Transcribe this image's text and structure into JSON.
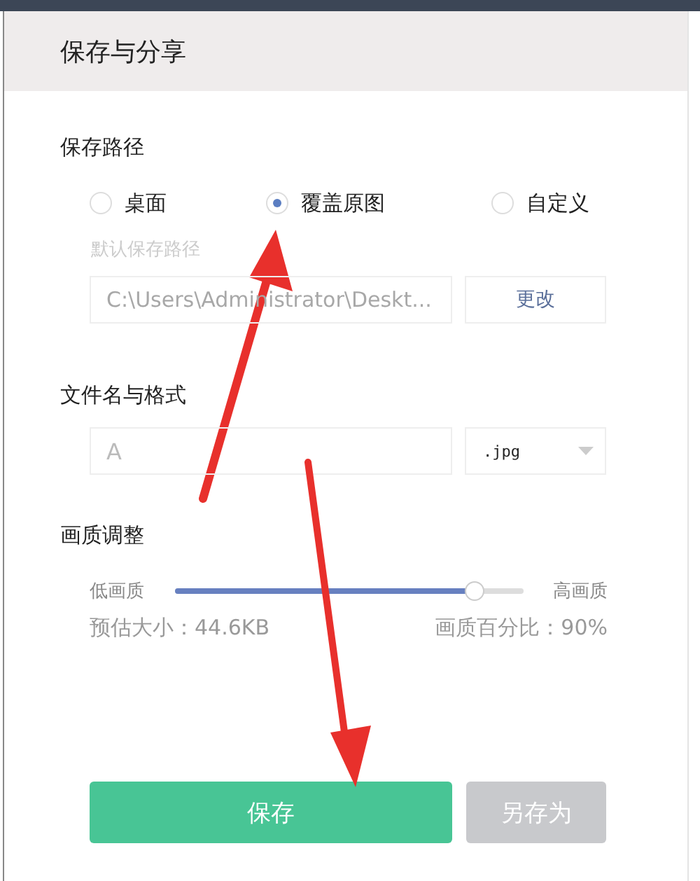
{
  "dialog": {
    "title": "保存与分享"
  },
  "save_path": {
    "label": "保存路径",
    "options": [
      {
        "label": "桌面",
        "selected": false
      },
      {
        "label": "覆盖原图",
        "selected": true
      },
      {
        "label": "自定义",
        "selected": false
      }
    ],
    "path_caption": "默认保存路径",
    "path_value": "C:\\Users\\Administrator\\Deskt...",
    "change_button": "更改",
    "disabled": true
  },
  "file": {
    "label": "文件名与格式",
    "name_value": "A",
    "format": ".jpg"
  },
  "quality": {
    "label": "画质调整",
    "low_label": "低画质",
    "high_label": "高画质",
    "level": 0.86,
    "size_text": "预估大小：44.6KB",
    "percent_text": "画质百分比：90%"
  },
  "buttons": [
    {
      "label": "保存",
      "kind": "primary"
    },
    {
      "label": "另存为",
      "kind": "secondary"
    }
  ]
}
